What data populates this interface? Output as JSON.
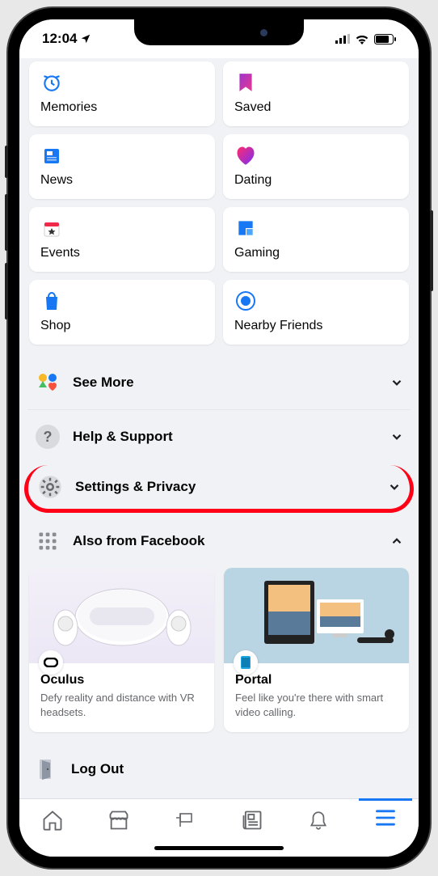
{
  "status": {
    "time": "12:04"
  },
  "shortcuts": [
    {
      "key": "memories",
      "label": "Memories"
    },
    {
      "key": "saved",
      "label": "Saved"
    },
    {
      "key": "news",
      "label": "News"
    },
    {
      "key": "dating",
      "label": "Dating"
    },
    {
      "key": "events",
      "label": "Events"
    },
    {
      "key": "gaming",
      "label": "Gaming"
    },
    {
      "key": "shop",
      "label": "Shop"
    },
    {
      "key": "nearby",
      "label": "Nearby Friends"
    }
  ],
  "menu": {
    "see_more": "See More",
    "help": "Help & Support",
    "settings": "Settings & Privacy",
    "also_from": "Also from Facebook"
  },
  "also_cards": [
    {
      "key": "oculus",
      "title": "Oculus",
      "desc": "Defy reality and distance with VR headsets."
    },
    {
      "key": "portal",
      "title": "Portal",
      "desc": "Feel like you're there with smart video calling."
    }
  ],
  "logout": "Log Out"
}
